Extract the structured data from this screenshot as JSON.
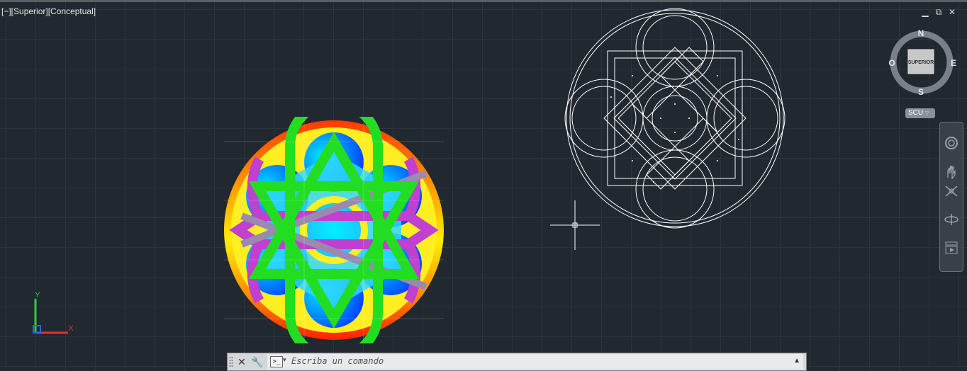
{
  "viewport": {
    "label": "[−][Superior][Conceptual]",
    "controls": {
      "minimize": "▁",
      "restore": "⧉",
      "close": "✕"
    }
  },
  "viewcube": {
    "face": "SUPERIOR",
    "north": "N",
    "south": "S",
    "east": "E",
    "west": "O",
    "ucs_label": "SCU"
  },
  "ucs_icon": {
    "y_label": "Y",
    "x_label": "X"
  },
  "navbar": {
    "items": [
      "steeringwheel-icon",
      "pan-icon",
      "zoom-icon",
      "orbit-icon",
      "showmotion-icon"
    ]
  },
  "command_line": {
    "placeholder": "Escriba un comando",
    "prompt_icon": ">_"
  },
  "colors": {
    "background": "#212830",
    "grid": "#2b3540",
    "wire": "#ffffff",
    "orange": "#ff5a00",
    "yellow": "#ffee00",
    "green": "#22dd22",
    "magenta": "#cc44cc",
    "blue": "#1040ff",
    "cyan": "#00e8ff"
  }
}
